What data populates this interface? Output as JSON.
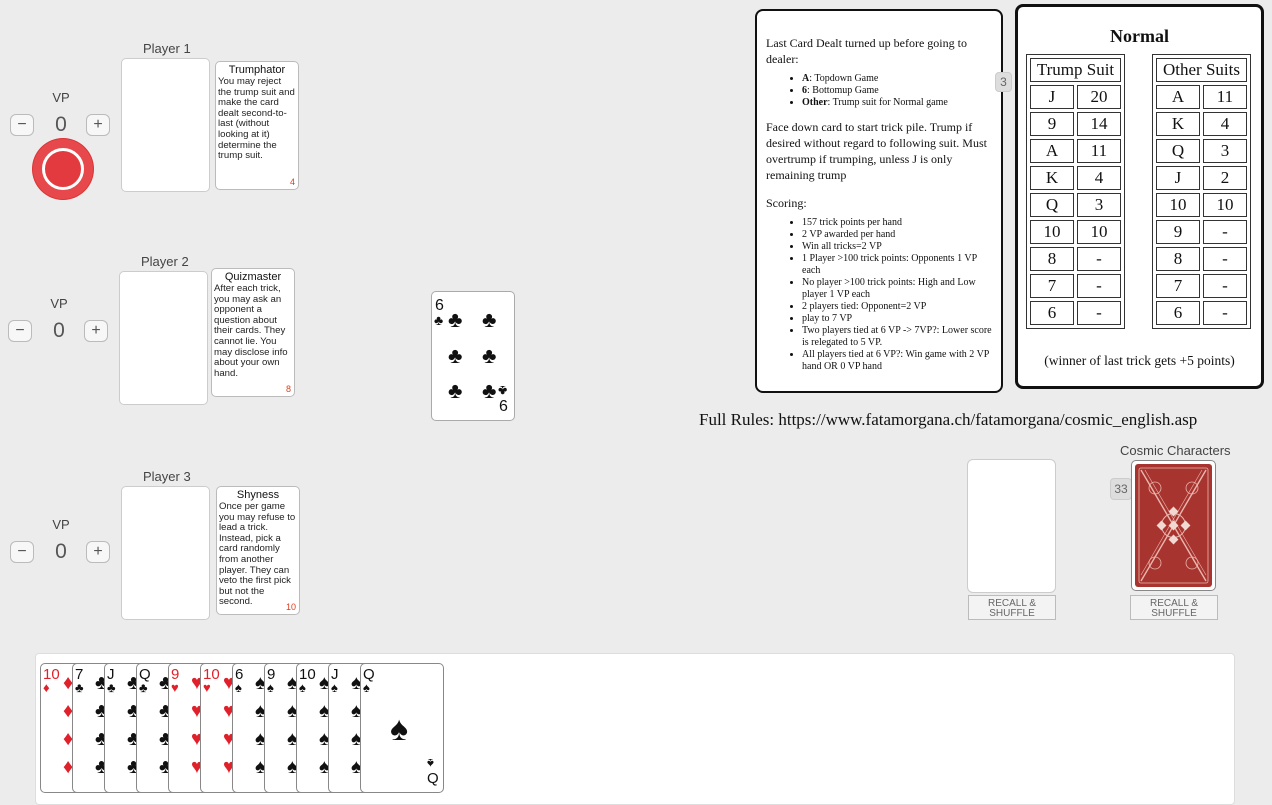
{
  "players": [
    {
      "label": "Player 1",
      "vp_label": "VP",
      "vp": "0",
      "minus": "−",
      "plus": "+",
      "character": {
        "name": "Trumphator",
        "text": "You may reject the trump suit and make the card dealt second-to-last (without looking at it) determine the trump suit.",
        "number": "4"
      }
    },
    {
      "label": "Player 2",
      "vp_label": "VP",
      "vp": "0",
      "minus": "−",
      "plus": "+",
      "character": {
        "name": "Quizmaster",
        "text": "After each trick, you may ask an opponent a question about their cards. They cannot lie. You may disclose info about your own hand.",
        "number": "8"
      }
    },
    {
      "label": "Player 3",
      "vp_label": "VP",
      "vp": "0",
      "minus": "−",
      "plus": "+",
      "character": {
        "name": "Shyness",
        "text": "Once per game you may refuse to lead a trick. Instead, pick a card randomly from another player. They can veto the first pick but not the second.",
        "number": "10"
      }
    }
  ],
  "trump_card": {
    "rank": "6",
    "suit": "♣",
    "color": "#111111"
  },
  "rules_card": {
    "intro": "Last Card Dealt turned up before going to dealer:",
    "modes": [
      {
        "key": "A",
        "desc": ": Topdown Game"
      },
      {
        "key": "6",
        "desc": ": Bottomup Game"
      },
      {
        "key": "Other",
        "desc": ": Trump suit for Normal game"
      }
    ],
    "play": "Face down card to start trick pile. Trump if desired without regard to following suit. Must overtrump if trumping, unless J is only remaining trump",
    "scoring_title": "Scoring:",
    "scoring": [
      "157 trick points per hand",
      "2 VP awarded per hand",
      "Win all tricks=2 VP",
      "1 Player >100 trick points: Opponents 1 VP each",
      "No player >100 trick points: High and Low player 1 VP each",
      "2 players tied: Opponent=2 VP",
      "play to 7 VP",
      "Two players tied at 6 VP -> 7VP?: Lower score is relegated to 5 VP.",
      "All players tied at 6 VP?: Win game with 2 VP hand OR 0 VP hand"
    ],
    "count": "3"
  },
  "points_table": {
    "title": "Normal",
    "trump_header": "Trump Suit",
    "other_header": "Other Suits",
    "trump_rows": [
      [
        "J",
        "20"
      ],
      [
        "9",
        "14"
      ],
      [
        "A",
        "11"
      ],
      [
        "K",
        "4"
      ],
      [
        "Q",
        "3"
      ],
      [
        "10",
        "10"
      ],
      [
        "8",
        "-"
      ],
      [
        "7",
        "-"
      ],
      [
        "6",
        "-"
      ]
    ],
    "other_rows": [
      [
        "A",
        "11"
      ],
      [
        "K",
        "4"
      ],
      [
        "Q",
        "3"
      ],
      [
        "J",
        "2"
      ],
      [
        "10",
        "10"
      ],
      [
        "9",
        "-"
      ],
      [
        "8",
        "-"
      ],
      [
        "7",
        "-"
      ],
      [
        "6",
        "-"
      ]
    ],
    "footer": "(winner of last trick gets +5 points)"
  },
  "full_rules": "Full Rules: https://www.fatamorgana.ch/fatamorgana/cosmic_english.asp",
  "discard": {
    "recall_label": "RECALL & SHUFFLE"
  },
  "cosmic": {
    "label": "Cosmic Characters",
    "count": "33",
    "recall_label": "RECALL & SHUFFLE",
    "back_color": "#a8342f"
  },
  "hand": [
    {
      "rank": "10",
      "suit": "♦",
      "red": true
    },
    {
      "rank": "7",
      "suit": "♣",
      "red": false
    },
    {
      "rank": "J",
      "suit": "♣",
      "red": false
    },
    {
      "rank": "Q",
      "suit": "♣",
      "red": false
    },
    {
      "rank": "9",
      "suit": "♥",
      "red": true
    },
    {
      "rank": "10",
      "suit": "♥",
      "red": true
    },
    {
      "rank": "6",
      "suit": "♠",
      "red": false
    },
    {
      "rank": "9",
      "suit": "♠",
      "red": false
    },
    {
      "rank": "10",
      "suit": "♠",
      "red": false
    },
    {
      "rank": "J",
      "suit": "♠",
      "red": false
    },
    {
      "rank": "Q",
      "suit": "♠",
      "red": false
    }
  ]
}
